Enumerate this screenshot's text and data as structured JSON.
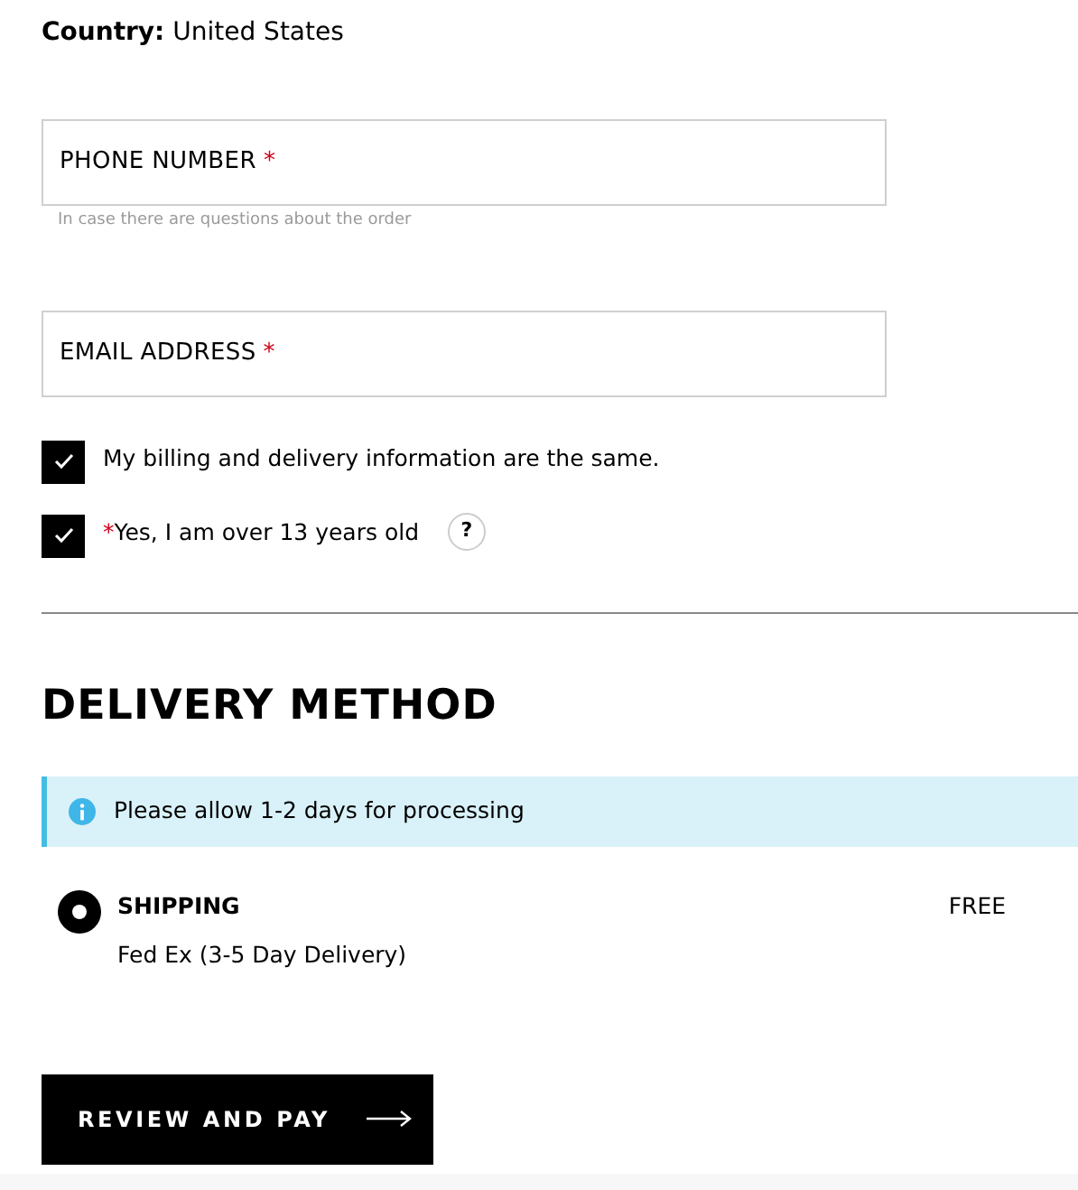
{
  "country": {
    "label": "Country:",
    "value": "United States"
  },
  "fields": [
    {
      "placeholder": "PHONE NUMBER",
      "required_mark": "*",
      "hint": "In case there are questions about the order"
    },
    {
      "placeholder": "EMAIL ADDRESS",
      "required_mark": "*"
    }
  ],
  "checkboxes": [
    {
      "label": "My billing and delivery information are the same.",
      "checked": true
    },
    {
      "required_mark": "*",
      "label": "Yes, I am over 13 years old",
      "checked": true,
      "help": "?"
    }
  ],
  "delivery": {
    "heading": "DELIVERY METHOD",
    "notice": "Please allow 1-2 days for processing",
    "options": [
      {
        "name": "SHIPPING",
        "carrier": "Fed Ex (3-5 Day Delivery)",
        "price": "FREE",
        "selected": true
      }
    ]
  },
  "submit": {
    "label": "REVIEW AND PAY"
  }
}
